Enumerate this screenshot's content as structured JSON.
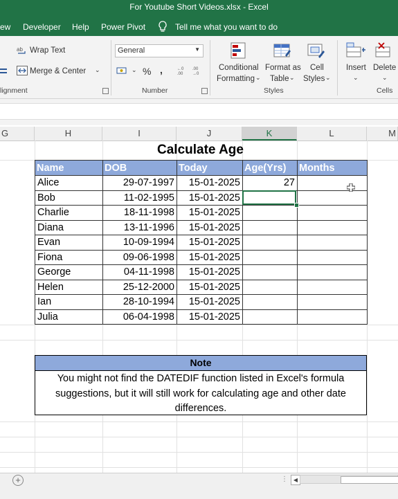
{
  "window": {
    "title": "For Youtube Short Videos.xlsx  -  Excel"
  },
  "menu": [
    "ew",
    "Developer",
    "Help",
    "Power Pivot",
    "Tell me what you want to do"
  ],
  "ribbon": {
    "alignment": {
      "wrap_text": "Wrap Text",
      "merge_center": "Merge & Center",
      "group_label": "lignment"
    },
    "number": {
      "format_value": "General",
      "percent": "%",
      "comma": ",",
      "group_label": "Number"
    },
    "styles": {
      "conditional_1": "Conditional",
      "conditional_2": "Formatting",
      "format_table_1": "Format as",
      "format_table_2": "Table",
      "cell_styles_1": "Cell",
      "cell_styles_2": "Styles",
      "group_label": "Styles"
    },
    "cells": {
      "insert": "Insert",
      "delete": "Delete",
      "group_label": "Cells"
    }
  },
  "columns": [
    "G",
    "H",
    "I",
    "J",
    "K",
    "L",
    "M"
  ],
  "sheet": {
    "title": "Calculate Age",
    "headers": [
      "Name",
      "DOB",
      "Today",
      "Age(Yrs)",
      "Months"
    ],
    "rows": [
      [
        "Alice",
        "29-07-1997",
        "15-01-2025",
        "27",
        ""
      ],
      [
        "Bob",
        "11-02-1995",
        "15-01-2025",
        "",
        ""
      ],
      [
        "Charlie",
        "18-11-1998",
        "15-01-2025",
        "",
        ""
      ],
      [
        "Diana",
        "13-11-1996",
        "15-01-2025",
        "",
        ""
      ],
      [
        "Evan",
        "10-09-1994",
        "15-01-2025",
        "",
        ""
      ],
      [
        "Fiona",
        "09-06-1998",
        "15-01-2025",
        "",
        ""
      ],
      [
        "George",
        "04-11-1998",
        "15-01-2025",
        "",
        ""
      ],
      [
        "Helen",
        "25-12-2000",
        "15-01-2025",
        "",
        ""
      ],
      [
        "Ian",
        "28-10-1994",
        "15-01-2025",
        "",
        ""
      ],
      [
        "Julia",
        "06-04-1998",
        "15-01-2025",
        "",
        ""
      ]
    ],
    "note": {
      "heading": "Note",
      "text": "You might not find the DATEDIF function listed in Excel's formula suggestions, but it will still work for calculating age and other date differences."
    }
  },
  "colors": {
    "accent": "#217346",
    "table_header": "#8ea9db"
  }
}
